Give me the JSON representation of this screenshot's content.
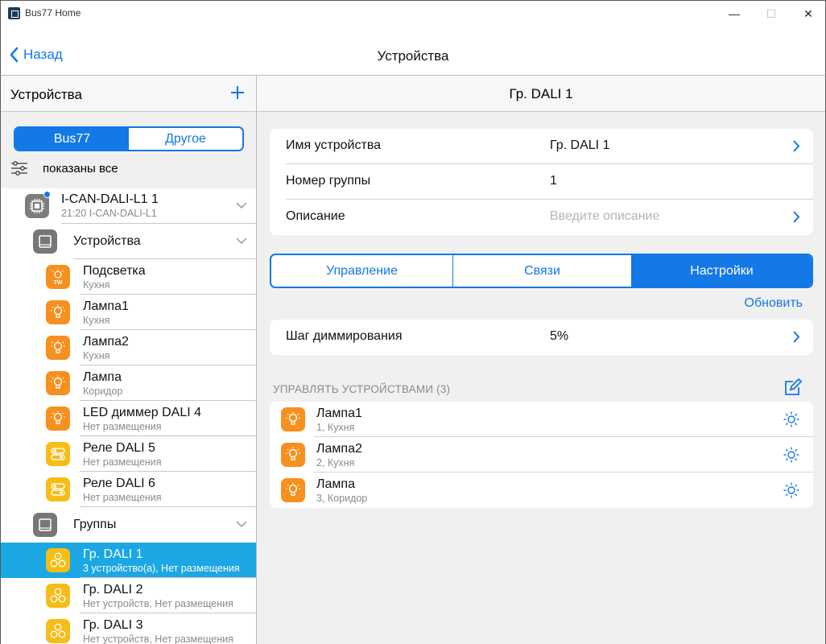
{
  "window": {
    "title": "Bus77 Home",
    "controls": {
      "minimize": "—",
      "maximize": "☐",
      "close": "✕"
    }
  },
  "navbar": {
    "back_label": "Назад",
    "title": "Устройства"
  },
  "left": {
    "title": "Устройства",
    "add_icon": "plus-icon",
    "segment": {
      "active": "Bus77",
      "inactive": "Другое"
    },
    "filter_label": "показаны все",
    "controller": {
      "name": "I-CAN-DALI-L1 1",
      "sub": "21:20 I-CAN-DALI-L1"
    },
    "devices_group_label": "Устройства",
    "devices": [
      {
        "name": "Подсветка",
        "sub": "Кухня",
        "icon": "tw-bulb-icon",
        "color": "#f7901e"
      },
      {
        "name": "Лампа1",
        "sub": "Кухня",
        "icon": "bulb-icon",
        "color": "#f7901e"
      },
      {
        "name": "Лампа2",
        "sub": "Кухня",
        "icon": "bulb-icon",
        "color": "#f7901e"
      },
      {
        "name": "Лампа",
        "sub": "Коридор",
        "icon": "bulb-icon",
        "color": "#f7901e"
      },
      {
        "name": "LED диммер DALI 4",
        "sub": "Нет размещения",
        "icon": "bulb-icon",
        "color": "#f7901e"
      },
      {
        "name": "Реле DALI 5",
        "sub": "Нет размещения",
        "icon": "relay-icon",
        "color": "#f6bd16"
      },
      {
        "name": "Реле DALI 6",
        "sub": "Нет размещения",
        "icon": "relay-icon",
        "color": "#f6bd16"
      }
    ],
    "groups_label": "Группы",
    "groups": [
      {
        "name": "Гр. DALI 1",
        "sub": "3 устройство(а), Нет размещения",
        "selected": true
      },
      {
        "name": "Гр. DALI 2",
        "sub": "Нет устройств, Нет размещения",
        "selected": false
      },
      {
        "name": "Гр. DALI 3",
        "sub": "Нет устройств, Нет размещения",
        "selected": false
      }
    ]
  },
  "right": {
    "title": "Гр. DALI 1",
    "props": {
      "name_label": "Имя устройства",
      "name_value": "Гр. DALI 1",
      "group_label": "Номер группы",
      "group_value": "1",
      "desc_label": "Описание",
      "desc_placeholder": "Введите описание"
    },
    "tabs": {
      "control": "Управление",
      "links": "Связи",
      "settings": "Настройки",
      "active": "Настройки"
    },
    "refresh_label": "Обновить",
    "dimming": {
      "label": "Шаг диммирования",
      "value": "5%"
    },
    "managed_header": "УПРАВЛЯТЬ УСТРОЙСТВАМИ (3)",
    "managed": [
      {
        "name": "Лампа1",
        "sub": "1, Кухня"
      },
      {
        "name": "Лампа2",
        "sub": "2, Кухня"
      },
      {
        "name": "Лампа",
        "sub": "3, Коридор"
      }
    ]
  },
  "colors": {
    "accent": "#1478e6",
    "selected_row": "#1aa7e4",
    "orange": "#f7901e",
    "yellow": "#f6bd16"
  }
}
